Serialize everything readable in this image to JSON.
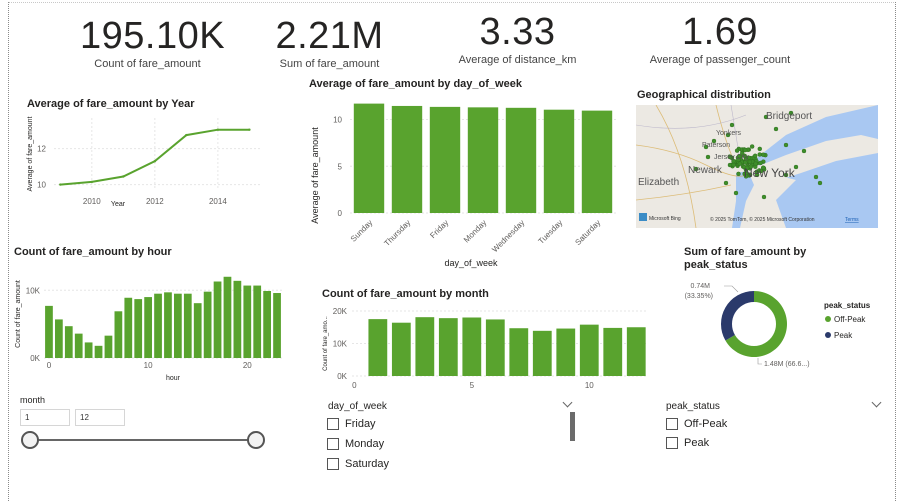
{
  "kpis": [
    {
      "value": "195.10K",
      "label": "Count of fare_amount"
    },
    {
      "value": "2.21M",
      "label": "Sum of fare_amount"
    },
    {
      "value": "3.33",
      "label": "Average of distance_km"
    },
    {
      "value": "1.69",
      "label": "Average of passenger_count"
    }
  ],
  "chart_data": [
    {
      "id": "year",
      "type": "line",
      "title": "Average of fare_amount by Year",
      "xlabel": "Year",
      "ylabel": "Average of fare_amount",
      "x": [
        2009,
        2010,
        2011,
        2012,
        2013,
        2014,
        2015
      ],
      "values": [
        10.0,
        10.15,
        10.45,
        11.3,
        12.75,
        13.05,
        13.05
      ],
      "xlim": [
        2008.8,
        2015.4
      ],
      "ylim": [
        9.7,
        13.7
      ],
      "xticks": [
        "2010",
        "2012",
        "2014"
      ],
      "yticks": [
        "10",
        "12"
      ],
      "color": "#59A32E"
    },
    {
      "id": "dow",
      "type": "bar",
      "title": "Average of fare_amount by day_of_week",
      "xlabel": "day_of_week",
      "ylabel": "Average of fare_amount",
      "categories": [
        "Sunday",
        "Thursday",
        "Friday",
        "Monday",
        "Wednesday",
        "Tuesday",
        "Saturday"
      ],
      "values": [
        11.7,
        11.45,
        11.35,
        11.3,
        11.25,
        11.05,
        10.95
      ],
      "ylim": [
        0,
        12.3
      ],
      "yticks": [
        "0",
        "5",
        "10"
      ],
      "color": "#59A32E"
    },
    {
      "id": "hour",
      "type": "bar",
      "title": "Count of fare_amount by hour",
      "xlabel": "hour",
      "ylabel": "Count of fare_amount",
      "categories": [
        "0",
        "1",
        "2",
        "3",
        "4",
        "5",
        "6",
        "7",
        "8",
        "9",
        "10",
        "11",
        "12",
        "13",
        "14",
        "15",
        "16",
        "17",
        "18",
        "19",
        "20",
        "21",
        "22",
        "23"
      ],
      "values": [
        7700,
        5700,
        4700,
        3600,
        2300,
        1800,
        3300,
        6900,
        8900,
        8700,
        9000,
        9500,
        9700,
        9500,
        9500,
        8100,
        9800,
        11300,
        12000,
        11400,
        10700,
        10700,
        9900,
        9600
      ],
      "ylim": [
        0,
        13000
      ],
      "yticks": [
        "0K",
        "10K"
      ],
      "xticks": [
        "0",
        "10",
        "20"
      ],
      "color": "#59A32E"
    },
    {
      "id": "month",
      "type": "bar",
      "title": "Count of fare_amount by month",
      "xlabel": "",
      "ylabel": "Count of fare_amo...",
      "categories": [
        "1",
        "2",
        "3",
        "4",
        "5",
        "6",
        "7",
        "8",
        "9",
        "10",
        "11",
        "12"
      ],
      "values": [
        17500,
        16400,
        18100,
        17800,
        18000,
        17400,
        14700,
        13900,
        14600,
        15800,
        14800,
        15000
      ],
      "ylim": [
        0,
        20000
      ],
      "yticks": [
        "0K",
        "10K",
        "20K"
      ],
      "xticks": [
        "0",
        "5",
        "10"
      ],
      "color": "#59A32E"
    },
    {
      "id": "peak",
      "type": "pie",
      "title": "Sum of fare_amount by peak_status",
      "legend_title": "peak_status",
      "slices": [
        {
          "name": "Off-Peak",
          "value": 1.48,
          "label": "1.48M (66.6...)",
          "color": "#59A32E"
        },
        {
          "name": "Peak",
          "value": 0.74,
          "label": "0.74M (33.35%)",
          "color": "#2B3A6B"
        }
      ]
    }
  ],
  "map": {
    "title": "Geographical distribution",
    "places": [
      "Bridgeport",
      "Yonkers",
      "New York",
      "Newark",
      "Elizabeth",
      "Paterson",
      "Jersey City"
    ],
    "attribution": "© 2025 TomTom, © 2025 Microsoft Corporation",
    "terms": "Terms",
    "brand": "Microsoft Bing",
    "colors": {
      "land": "#ECE9E3",
      "water": "#A9C8F2",
      "point": "#3E8E2A"
    }
  },
  "slicers": {
    "month": {
      "title": "month",
      "min": "1",
      "max": "12"
    },
    "day_of_week": {
      "title": "day_of_week",
      "options": [
        "Friday",
        "Monday",
        "Saturday"
      ]
    },
    "peak_status": {
      "title": "peak_status",
      "options": [
        "Off-Peak",
        "Peak"
      ]
    }
  }
}
